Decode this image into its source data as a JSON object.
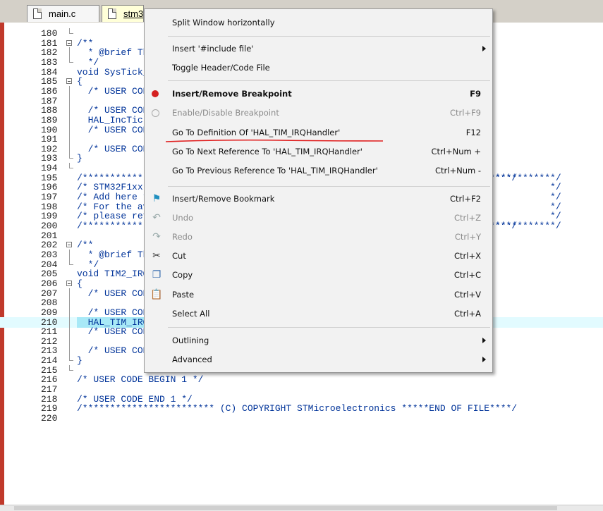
{
  "tabs": [
    {
      "label": "main.c",
      "active": false
    },
    {
      "label": "stm32f1xx_it.c",
      "active": true
    }
  ],
  "code_lines": [
    {
      "ln": "180",
      "fold": "end",
      "text": ""
    },
    {
      "ln": "181",
      "fold": "box",
      "text": "/**"
    },
    {
      "ln": "182",
      "fold": "bar",
      "text": "  * @brief This function handles System tick timer."
    },
    {
      "ln": "183",
      "fold": "end",
      "text": "  */"
    },
    {
      "ln": "184",
      "fold": "",
      "text": "void SysTick_Handler(void)"
    },
    {
      "ln": "185",
      "fold": "box",
      "text": "{"
    },
    {
      "ln": "186",
      "fold": "bar",
      "text": "  /* USER CODE BEGIN SysTick_IRQn 0 */"
    },
    {
      "ln": "187",
      "fold": "bar",
      "text": ""
    },
    {
      "ln": "188",
      "fold": "bar",
      "text": "  /* USER CODE END SysTick_IRQn 0 */"
    },
    {
      "ln": "189",
      "fold": "bar",
      "text": "  HAL_IncTick();"
    },
    {
      "ln": "190",
      "fold": "bar",
      "text": "  /* USER CODE BEGIN SysTick_IRQn 1 */"
    },
    {
      "ln": "191",
      "fold": "bar",
      "text": ""
    },
    {
      "ln": "192",
      "fold": "bar",
      "text": "  /* USER CODE END SysTick_IRQn 1 */"
    },
    {
      "ln": "193",
      "fold": "end",
      "text": "}"
    },
    {
      "ln": "194",
      "fold": "end",
      "text": ""
    },
    {
      "ln": "195",
      "fold": "",
      "text": "/******************************************************************************/",
      "right": "***********/"
    },
    {
      "ln": "196",
      "fold": "",
      "text": "/* STM32F1xx Peripheral Interrupt Handlers",
      "right": "          */"
    },
    {
      "ln": "197",
      "fold": "",
      "text": "/* Add here the Interrupt Handlers for the used peripherals.",
      "right": "          */"
    },
    {
      "ln": "198",
      "fold": "",
      "text": "/* For the available peripheral interrupt handler names,",
      "right": "          */"
    },
    {
      "ln": "199",
      "fold": "",
      "text": "/* please refer to the startup file (startup_stm32f1xx.s).",
      "right": "          */"
    },
    {
      "ln": "200",
      "fold": "",
      "text": "/******************************************************************************/",
      "right": "***********/"
    },
    {
      "ln": "201",
      "fold": "",
      "text": ""
    },
    {
      "ln": "202",
      "fold": "box",
      "text": "/**"
    },
    {
      "ln": "203",
      "fold": "bar",
      "text": "  * @brief This function handles TIM2 global interrupt."
    },
    {
      "ln": "204",
      "fold": "end",
      "text": "  */"
    },
    {
      "ln": "205",
      "fold": "",
      "text": "void TIM2_IRQHandler(void)"
    },
    {
      "ln": "206",
      "fold": "box",
      "text": "{"
    },
    {
      "ln": "207",
      "fold": "bar",
      "text": "  /* USER CODE BEGIN TIM2_IRQn 0 */"
    },
    {
      "ln": "208",
      "fold": "bar",
      "text": ""
    },
    {
      "ln": "209",
      "fold": "bar",
      "text": "  /* USER CODE END TIM2_IRQn 0 */"
    },
    {
      "ln": "210",
      "fold": "bar",
      "text": "  HAL_TIM_IRQHandler(&htim2);",
      "highlight": true
    },
    {
      "ln": "211",
      "fold": "bar",
      "text": "  /* USER CODE BEGIN TIM2_IRQn 1 */"
    },
    {
      "ln": "212",
      "fold": "bar",
      "text": ""
    },
    {
      "ln": "213",
      "fold": "bar",
      "text": "  /* USER CODE END TIM2_IRQn 1 */"
    },
    {
      "ln": "214",
      "fold": "end",
      "text": "}"
    },
    {
      "ln": "215",
      "fold": "end",
      "text": ""
    },
    {
      "ln": "216",
      "fold": "",
      "text": "/* USER CODE BEGIN 1 */"
    },
    {
      "ln": "217",
      "fold": "",
      "text": ""
    },
    {
      "ln": "218",
      "fold": "",
      "text": "/* USER CODE END 1 */"
    },
    {
      "ln": "219",
      "fold": "",
      "text": "/************************ (C) COPYRIGHT STMicroelectronics *****END OF FILE****/"
    },
    {
      "ln": "220",
      "fold": "",
      "text": ""
    }
  ],
  "menu": [
    {
      "label": "Split Window horizontally",
      "shortcut": "",
      "icon": "",
      "disabled": false,
      "bold": false,
      "submenu": false,
      "sep_after": true
    },
    {
      "label": "Insert '#include file'",
      "shortcut": "",
      "icon": "",
      "disabled": false,
      "bold": false,
      "submenu": true,
      "sep_after": false
    },
    {
      "label": "Toggle Header/Code File",
      "shortcut": "",
      "icon": "",
      "disabled": false,
      "bold": false,
      "submenu": false,
      "sep_after": true
    },
    {
      "label": "Insert/Remove Breakpoint",
      "shortcut": "F9",
      "icon": "breakpoint-icon",
      "disabled": false,
      "bold": true,
      "submenu": false,
      "sep_after": false
    },
    {
      "label": "Enable/Disable Breakpoint",
      "shortcut": "Ctrl+F9",
      "icon": "breakpoint-disabled-icon",
      "disabled": true,
      "bold": false,
      "submenu": false,
      "sep_after": false
    },
    {
      "label": "Go To Definition Of 'HAL_TIM_IRQHandler'",
      "shortcut": "F12",
      "icon": "",
      "disabled": false,
      "bold": false,
      "submenu": false,
      "sep_after": false
    },
    {
      "label": "Go To Next Reference To 'HAL_TIM_IRQHandler'",
      "shortcut": "Ctrl+Num +",
      "icon": "",
      "disabled": false,
      "bold": false,
      "submenu": false,
      "sep_after": false
    },
    {
      "label": "Go To Previous Reference To 'HAL_TIM_IRQHandler'",
      "shortcut": "Ctrl+Num -",
      "icon": "",
      "disabled": false,
      "bold": false,
      "submenu": false,
      "sep_after": true
    },
    {
      "label": "Insert/Remove Bookmark",
      "shortcut": "Ctrl+F2",
      "icon": "bookmark-flag-icon",
      "disabled": false,
      "bold": false,
      "submenu": false,
      "sep_after": false
    },
    {
      "label": "Undo",
      "shortcut": "Ctrl+Z",
      "icon": "undo-icon",
      "disabled": true,
      "bold": false,
      "submenu": false,
      "sep_after": false
    },
    {
      "label": "Redo",
      "shortcut": "Ctrl+Y",
      "icon": "redo-icon",
      "disabled": true,
      "bold": false,
      "submenu": false,
      "sep_after": false
    },
    {
      "label": "Cut",
      "shortcut": "Ctrl+X",
      "icon": "scissors-icon",
      "disabled": false,
      "bold": false,
      "submenu": false,
      "sep_after": false
    },
    {
      "label": "Copy",
      "shortcut": "Ctrl+C",
      "icon": "copy-icon",
      "disabled": false,
      "bold": false,
      "submenu": false,
      "sep_after": false
    },
    {
      "label": "Paste",
      "shortcut": "Ctrl+V",
      "icon": "paste-icon",
      "disabled": false,
      "bold": false,
      "submenu": false,
      "sep_after": false
    },
    {
      "label": "Select All",
      "shortcut": "Ctrl+A",
      "icon": "",
      "disabled": false,
      "bold": false,
      "submenu": false,
      "sep_after": true
    },
    {
      "label": "Outlining",
      "shortcut": "",
      "icon": "",
      "disabled": false,
      "bold": false,
      "submenu": true,
      "sep_after": false
    },
    {
      "label": "Advanced",
      "shortcut": "",
      "icon": "",
      "disabled": false,
      "bold": false,
      "submenu": true,
      "sep_after": false
    }
  ],
  "colors": {
    "code_text": "#003399",
    "highlight_line": "#e2fbff",
    "highlight_word": "#a8e9f7",
    "annotation_underline": "#e02020",
    "breakpoint": "#d42020"
  }
}
